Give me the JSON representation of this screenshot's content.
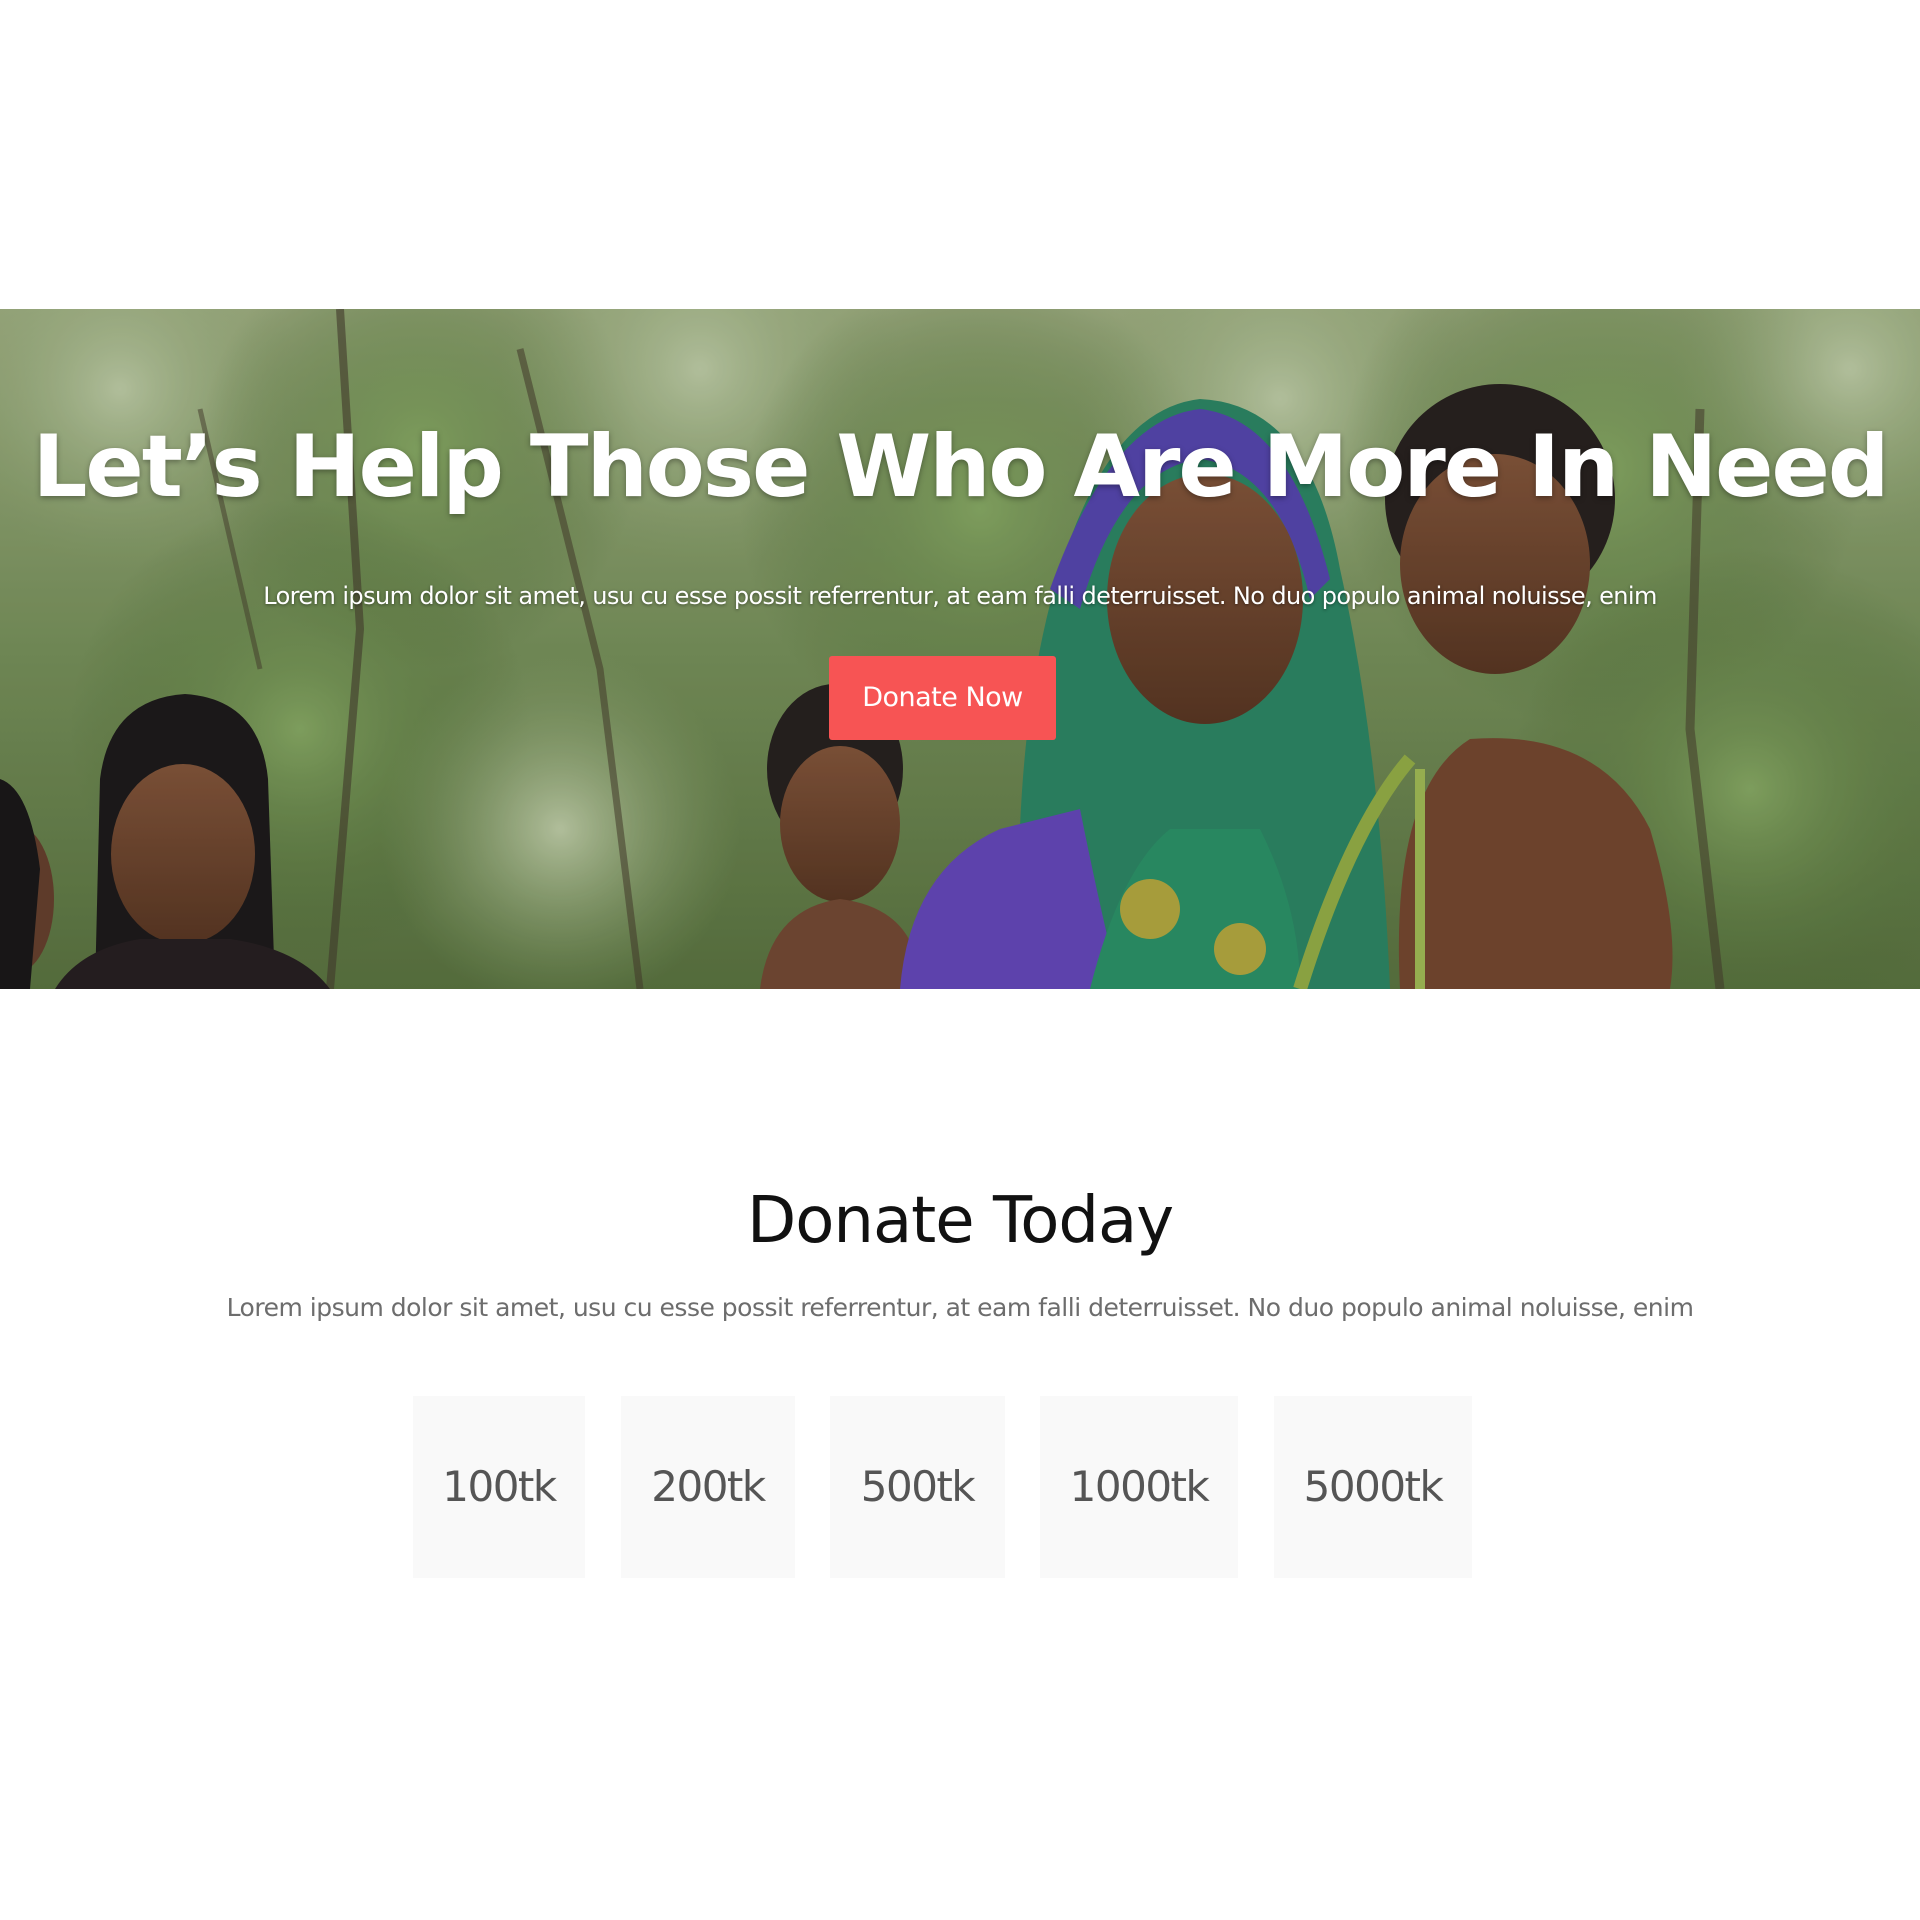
{
  "hero": {
    "title": "Let’s Help Those Who Are More In Need",
    "subtitle": "Lorem ipsum dolor sit amet, usu cu esse possit referrentur, at eam falli deterruisset. No duo populo animal noluisse, enim",
    "cta_label": "Donate Now",
    "cta_color": "#f75454"
  },
  "donate": {
    "title": "Donate Today",
    "subtitle": "Lorem ipsum dolor sit amet, usu cu esse possit referrentur, at eam falli deterruisset. No duo populo animal noluisse, enim",
    "amounts": [
      "100tk",
      "200tk",
      "500tk",
      "1000tk",
      "5000tk"
    ]
  }
}
